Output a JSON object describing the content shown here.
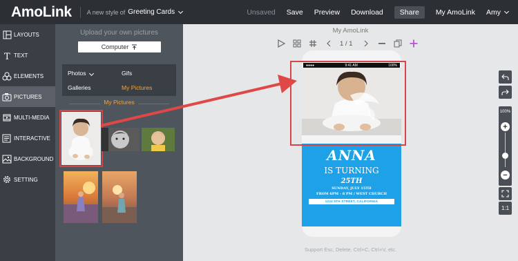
{
  "header": {
    "logo": "AmoLink",
    "tagline": "A new style of",
    "style_selected": "Greeting Cards",
    "unsaved": "Unsaved",
    "save": "Save",
    "preview": "Preview",
    "download": "Download",
    "share": "Share",
    "my_amolink": "My AmoLink",
    "user": "Amy"
  },
  "sidebar": {
    "items": [
      {
        "label": "LAYOUTS",
        "icon": "layouts-icon"
      },
      {
        "label": "TEXT",
        "icon": "text-icon"
      },
      {
        "label": "ELEMENTS",
        "icon": "elements-icon"
      },
      {
        "label": "PICTURES",
        "icon": "camera-icon"
      },
      {
        "label": "MULTI-MEDIA",
        "icon": "media-icon"
      },
      {
        "label": "INTERACTIVE",
        "icon": "interactive-icon"
      },
      {
        "label": "BACKGROUND",
        "icon": "background-icon"
      },
      {
        "label": "SETTING",
        "icon": "gear-icon"
      }
    ]
  },
  "panel": {
    "upload_title": "Upload your own pictures",
    "computer_button": "Computer",
    "sources": {
      "photos": "Photos",
      "gifs": "Gifs",
      "galleries": "Galleries",
      "my_pictures": "My Pictures"
    },
    "section_label": "My Pictures"
  },
  "canvas": {
    "title": "My AmoLink",
    "pager": "1 / 1",
    "hint": "Support Esc, Delete, Ctrl+C, Ctrl+V, etc."
  },
  "phone": {
    "time": "9:41 AM",
    "battery": "100%",
    "card": {
      "name": "ANNA",
      "turning": "IS TURNING",
      "age": "25TH",
      "date": "SUNDAY, JULY 15TH",
      "time": "FROM 6PM - 8 PM / WEST CHURCH",
      "address": "1234 5TH STREET, CALIFORNIA"
    }
  },
  "zoom": {
    "percent": "100%",
    "ratio": "1:1",
    "level": 1.0
  },
  "colors": {
    "topbar": "#2c3035",
    "accent_orange": "#f0a640",
    "card_blue": "#1fa1e8",
    "highlight_red": "#d64545",
    "add_purple": "#b84fd6"
  }
}
